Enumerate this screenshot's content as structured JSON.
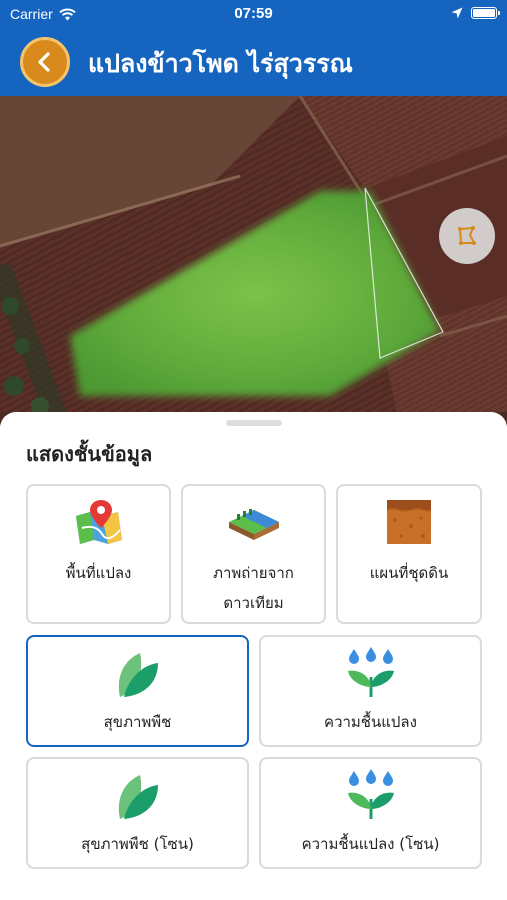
{
  "status_bar": {
    "carrier": "Carrier",
    "time": "07:59",
    "battery_level": 1.0
  },
  "header": {
    "title": "แปลงข้าวโพด ไร่สุวรรณ",
    "back_icon": "chevron-left-icon",
    "background_color": "#1565c0",
    "back_button_color": "#d88a1c"
  },
  "map": {
    "polygon_button_icon": "polygon-icon"
  },
  "sheet": {
    "title": "แสดงชั้นข้อมูล",
    "layers": [
      {
        "label": "พื้นที่แปลง",
        "icon": "map-pin-icon",
        "selected": false
      },
      {
        "label_line1": "ภาพถ่ายจาก",
        "label_line2": "ดาวเทียม",
        "icon": "satellite-land-icon",
        "selected": false
      },
      {
        "label": "แผนที่ชุดดิน",
        "icon": "soil-icon",
        "selected": false
      },
      {
        "label": "สุขภาพพืช",
        "icon": "leaf-icon",
        "selected": true
      },
      {
        "label": "ความชื้นแปลง",
        "icon": "plant-water-drops-icon",
        "selected": false
      },
      {
        "label": "สุขภาพพืช (โซน)",
        "icon": "leaf-icon",
        "selected": false
      },
      {
        "label": "ความชื้นแปลง (โซน)",
        "icon": "plant-water-drops-icon",
        "selected": false
      }
    ],
    "selected_color": "#1565c0"
  }
}
